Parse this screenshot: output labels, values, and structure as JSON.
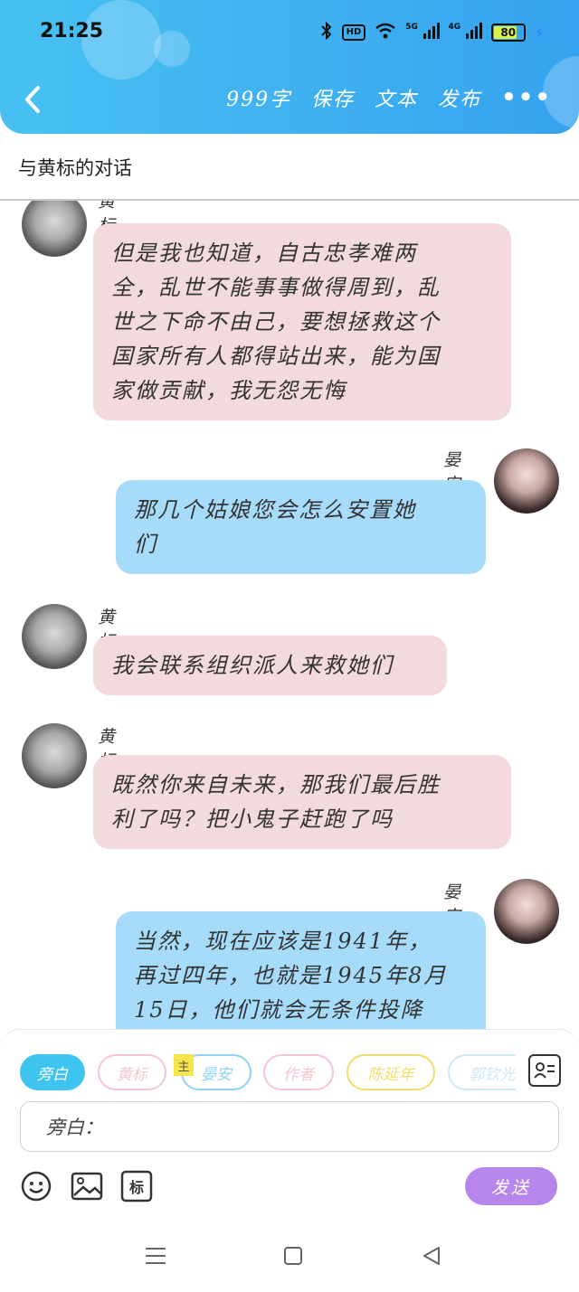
{
  "status_bar": {
    "time": "21:25",
    "network_hd": "HD",
    "signal_5g": "5G",
    "signal_4g": "4G",
    "battery_level": 80,
    "battery_text": "80"
  },
  "header": {
    "word_count": "999字",
    "save": "保存",
    "text": "文本",
    "publish": "发布",
    "more": "•••"
  },
  "conversation": {
    "title": "与黄标的对话"
  },
  "messages": [
    {
      "side": "left",
      "sender": "黄标",
      "text_lines": [
        "但是我也知道，自古忠孝难两",
        "全，乱世不能事事做得周到，乱",
        "世之下命不由己，要想拯救这个",
        "国家所有人都得站出来，能为国",
        "家做贡献，我无怨无悔"
      ]
    },
    {
      "side": "right",
      "sender": "晏安",
      "text_lines": [
        "那几个姑娘您会怎么安置她",
        "们"
      ]
    },
    {
      "side": "left",
      "sender": "黄标",
      "text_lines": [
        "我会联系组织派人来救她们"
      ]
    },
    {
      "side": "left",
      "sender": "黄标",
      "text_lines": [
        "既然你来自未来，那我们最后胜",
        "利了吗？把小鬼子赶跑了吗"
      ]
    },
    {
      "side": "right",
      "sender": "晏安",
      "text_lines": [
        "当然，现在应该是1941年，",
        "再过四年，也就是1945年8月",
        "15日，他们就会无条件投降"
      ]
    }
  ],
  "composer": {
    "roles": [
      {
        "label": "旁白",
        "active": true,
        "color": "#3fc4ef"
      },
      {
        "label": "黄标",
        "active": false,
        "color": "#f5c6cf"
      },
      {
        "label": "晏安",
        "active": false,
        "color": "#8fd3f7"
      },
      {
        "label": "作者",
        "active": false,
        "color": "#f5c6cf"
      },
      {
        "label": "陈延年",
        "active": false,
        "color": "#f2dc6a"
      },
      {
        "label": "郭钦光",
        "active": false,
        "color": "#cfe6f5"
      }
    ],
    "main_badge": "主",
    "input_value": "旁白：",
    "send_label": "发送",
    "tag_label": "标"
  }
}
